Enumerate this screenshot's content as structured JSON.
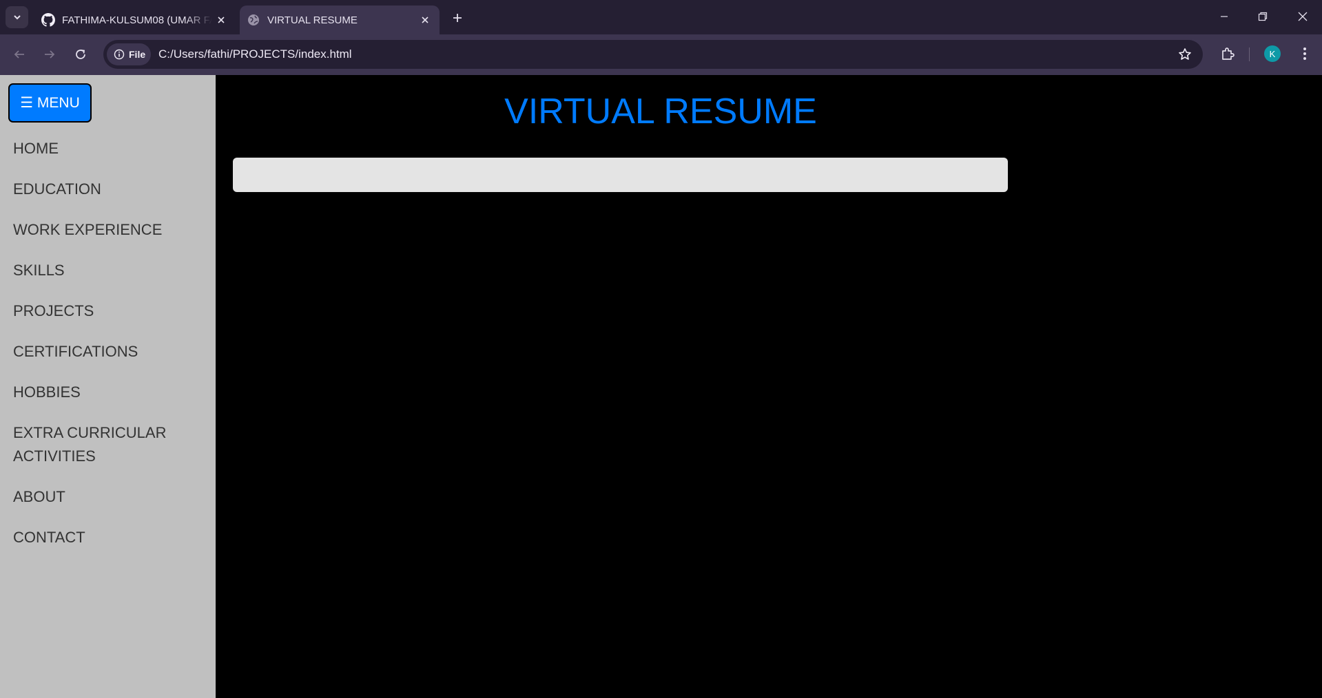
{
  "browser": {
    "tabs": [
      {
        "title": "FATHIMA-KULSUM08 (UMAR FA",
        "favicon": "github-icon",
        "active": false
      },
      {
        "title": "VIRTUAL RESUME",
        "favicon": "globe-icon",
        "active": true
      }
    ],
    "site_chip": "File",
    "url": "C:/Users/fathi/PROJECTS/index.html",
    "profile_initial": "K"
  },
  "sidebar": {
    "menu_button": "☰ MENU",
    "items": [
      {
        "label": "HOME"
      },
      {
        "label": "EDUCATION"
      },
      {
        "label": "WORK EXPERIENCE"
      },
      {
        "label": "SKILLS"
      },
      {
        "label": "PROJECTS"
      },
      {
        "label": "CERTIFICATIONS"
      },
      {
        "label": "HOBBIES"
      },
      {
        "label": "EXTRA CURRICULAR ACTIVITIES"
      },
      {
        "label": "ABOUT"
      },
      {
        "label": "CONTACT"
      }
    ]
  },
  "main": {
    "title": "VIRTUAL RESUME",
    "search_value": ""
  },
  "colors": {
    "accent": "#007bff",
    "sidebar_bg": "#c0c0c0",
    "page_bg": "#000000",
    "chrome_dark": "#251f33",
    "chrome_light": "#3d3550"
  }
}
